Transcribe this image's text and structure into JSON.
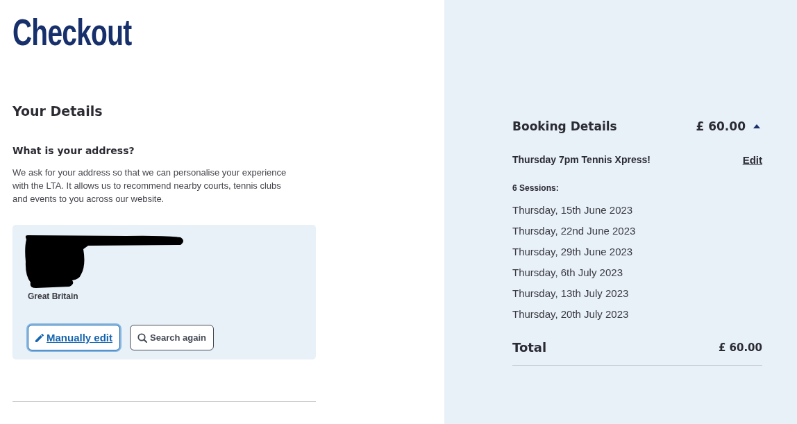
{
  "page_title": "Checkout",
  "details": {
    "heading": "Your Details",
    "question": "What is your address?",
    "description": "We ask for your address so that we can personalise your experience with the LTA. It allows us to recommend nearby courts, tennis clubs and events to you across our website.",
    "address": {
      "country": "Great Britain"
    },
    "buttons": [
      {
        "kind": "edit",
        "label": "Manually edit",
        "focused": true
      },
      {
        "kind": "search",
        "label": "Search again",
        "focused": false
      }
    ]
  },
  "booking": {
    "title": "Booking Details",
    "price": "£ 60.00",
    "expanded": true,
    "item": {
      "name": "Thursday 7pm Tennis Xpress!",
      "edit_link": "Edit"
    },
    "sessions_label": "6 Sessions:",
    "sessions": [
      "Thursday, 15th June 2023",
      "Thursday, 22nd June 2023",
      "Thursday, 29th June 2023",
      "Thursday, 6th July 2023",
      "Thursday, 13th July 2023",
      "Thursday, 20th July 2023"
    ],
    "total_label": "Total",
    "total": "£ 60.00"
  }
}
